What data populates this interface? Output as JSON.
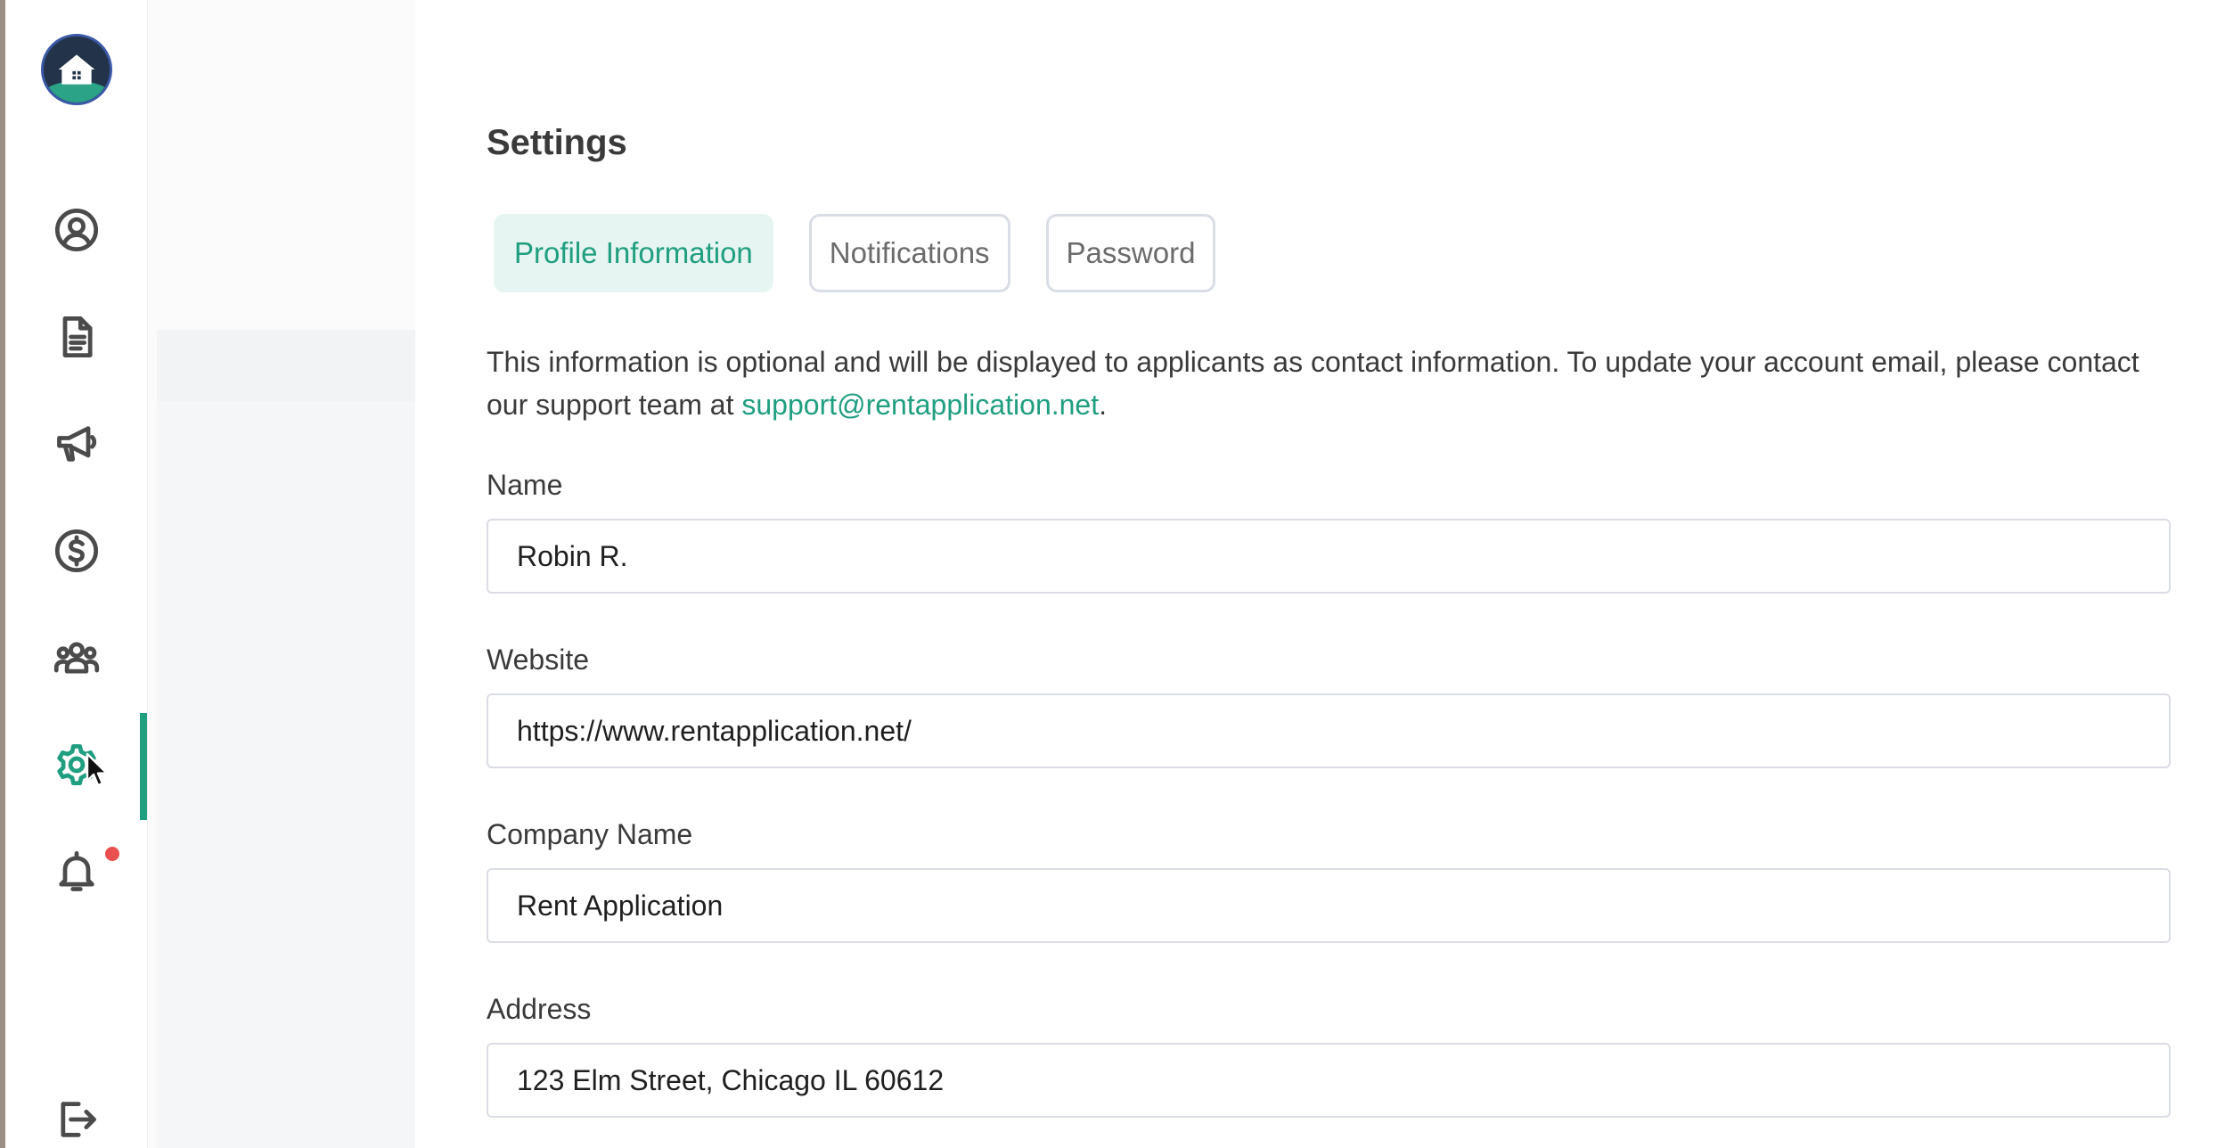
{
  "sidebar": {
    "logo_icon": "house-logo-icon",
    "items": [
      {
        "icon": "user-circle-icon"
      },
      {
        "icon": "document-icon"
      },
      {
        "icon": "megaphone-icon"
      },
      {
        "icon": "dollar-circle-icon"
      },
      {
        "icon": "users-group-icon"
      },
      {
        "icon": "gear-icon",
        "active": true
      },
      {
        "icon": "bell-icon",
        "has_notification": true
      }
    ],
    "logout_icon": "logout-icon",
    "accent_color": "#1f9e80",
    "notification_color": "#e94f4f"
  },
  "page": {
    "title": "Settings"
  },
  "tabs": [
    {
      "label": "Profile Information",
      "active": true
    },
    {
      "label": "Notifications",
      "active": false
    },
    {
      "label": "Password",
      "active": false
    }
  ],
  "intro": {
    "text_before": "This information is optional and will be displayed to applicants as contact information. To update your account email, please contact our support team at ",
    "link_text": "support@rentapplication.net",
    "text_after": "."
  },
  "form": {
    "name": {
      "label": "Name",
      "value": "Robin R."
    },
    "website": {
      "label": "Website",
      "value": "https://www.rentapplication.net/"
    },
    "company": {
      "label": "Company Name",
      "value": "Rent Application"
    },
    "address": {
      "label": "Address",
      "value": "123 Elm Street, Chicago IL 60612"
    }
  }
}
